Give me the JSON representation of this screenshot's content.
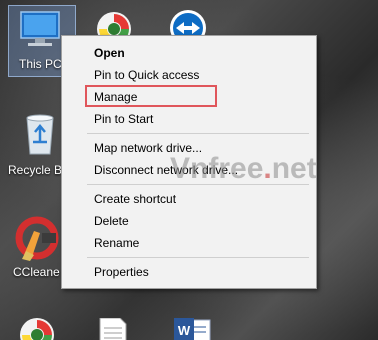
{
  "desktop": {
    "icons": [
      {
        "label": "This PC",
        "icon": "computer-icon"
      },
      {
        "label": "Recycle B",
        "icon": "recycle-bin-icon"
      },
      {
        "label": "CCleane",
        "icon": "ccleaner-icon"
      }
    ],
    "top_icons": [
      {
        "icon": "cococ-browser-icon"
      },
      {
        "icon": "teamviewer-icon"
      }
    ],
    "bottom_icons": [
      {
        "icon": "cococ-browser-icon"
      },
      {
        "icon": "text-file-icon"
      },
      {
        "icon": "word-document-icon"
      }
    ]
  },
  "context_menu": {
    "items": [
      {
        "label": "Open",
        "bold": true
      },
      {
        "label": "Pin to Quick access"
      },
      {
        "label": "Manage",
        "highlighted": true
      },
      {
        "label": "Pin to Start"
      },
      {
        "label": "Map network drive..."
      },
      {
        "label": "Disconnect network drive..."
      },
      {
        "label": "Create shortcut"
      },
      {
        "label": "Delete"
      },
      {
        "label": "Rename"
      },
      {
        "label": "Properties"
      }
    ]
  },
  "watermark": {
    "text_a": "Vn",
    "text_b": "free",
    "dot": ".",
    "text_c": "net"
  },
  "colors": {
    "highlight_border": "#e0565b",
    "menu_bg": "#f2f2f2"
  }
}
